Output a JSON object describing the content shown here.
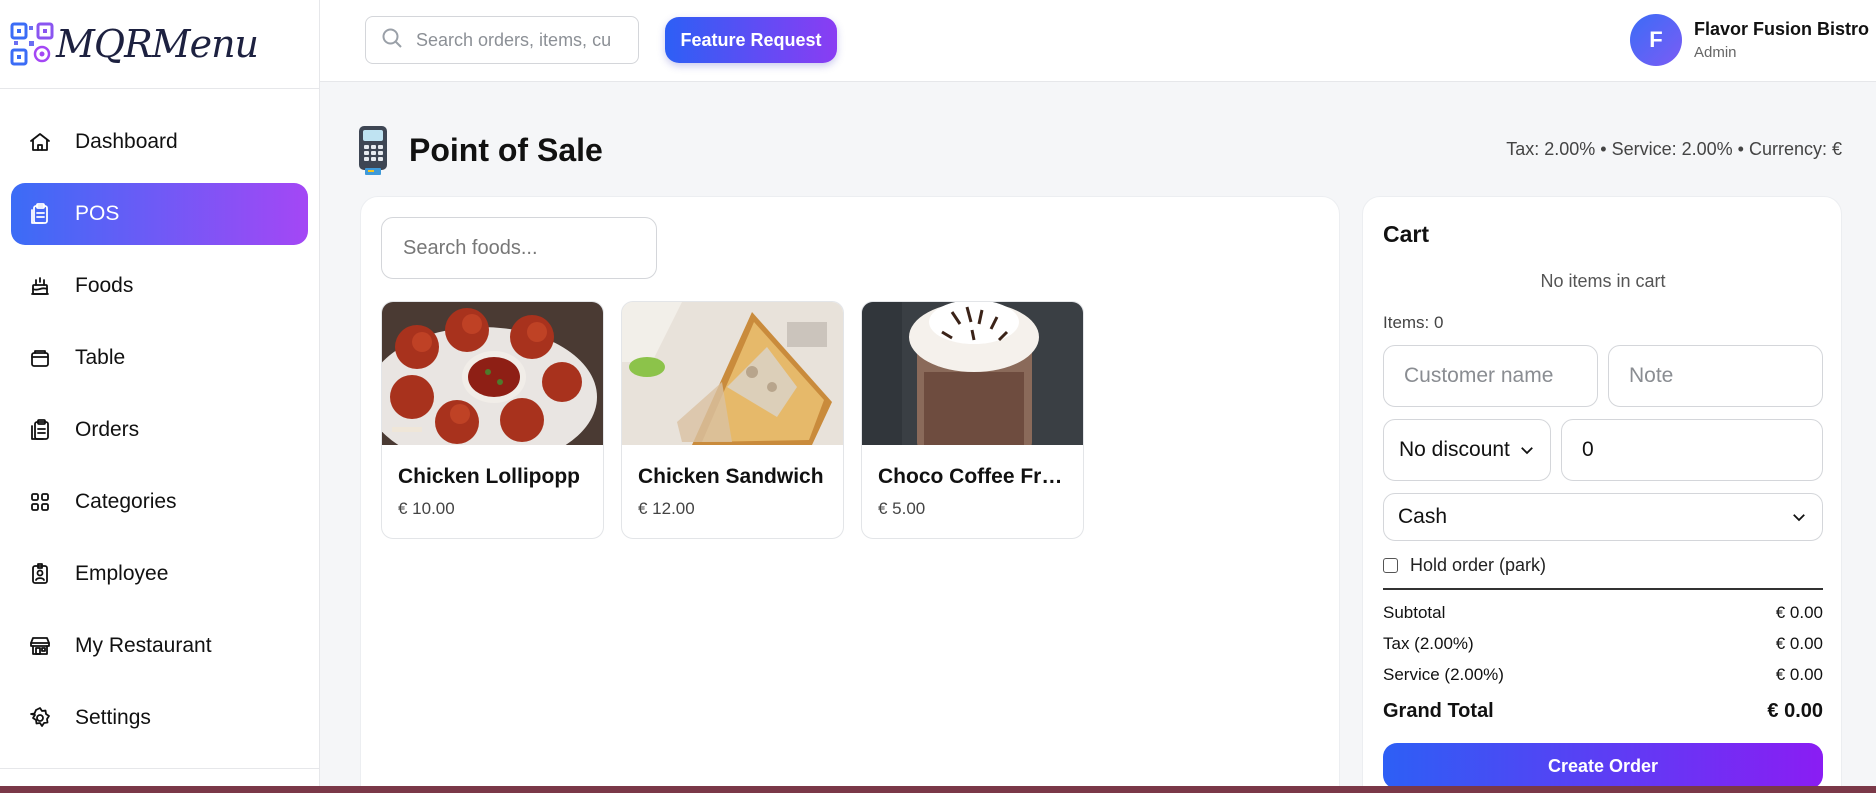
{
  "app": {
    "logo_text": "MQRMenu"
  },
  "sidebar": {
    "items": [
      {
        "label": "Dashboard",
        "icon": "home-icon",
        "active": false
      },
      {
        "label": "POS",
        "icon": "clipboard-icon",
        "active": true
      },
      {
        "label": "Foods",
        "icon": "cake-icon",
        "active": false
      },
      {
        "label": "Table",
        "icon": "table-icon",
        "active": false
      },
      {
        "label": "Orders",
        "icon": "orders-icon",
        "active": false
      },
      {
        "label": "Categories",
        "icon": "grid-icon",
        "active": false
      },
      {
        "label": "Employee",
        "icon": "badge-icon",
        "active": false
      },
      {
        "label": "My Restaurant",
        "icon": "store-icon",
        "active": false
      },
      {
        "label": "Settings",
        "icon": "gear-icon",
        "active": false
      }
    ]
  },
  "topbar": {
    "search_placeholder": "Search orders, items, cu",
    "feature_label": "Feature Request",
    "user": {
      "initial": "F",
      "name": "Flavor Fusion Bistro",
      "role": "Admin"
    }
  },
  "page": {
    "title": "Point of Sale",
    "meta": "Tax: 2.00% • Service: 2.00% • Currency: €"
  },
  "foods": {
    "search_placeholder": "Search foods...",
    "items": [
      {
        "name": "Chicken Lollipopp",
        "price": "€ 10.00"
      },
      {
        "name": "Chicken Sandwich",
        "price": "€ 12.00"
      },
      {
        "name": "Choco Coffee Freeze",
        "price": "€ 5.00"
      }
    ]
  },
  "cart": {
    "title": "Cart",
    "empty_text": "No items in cart",
    "items_count": "Items: 0",
    "customer_placeholder": "Customer name",
    "note_placeholder": "Note",
    "discount_value": "No discount",
    "discount_amount": "0",
    "payment_value": "Cash",
    "hold_label": "Hold order (park)",
    "summary": [
      {
        "label": "Subtotal",
        "value": "€ 0.00"
      },
      {
        "label": "Tax (2.00%)",
        "value": "€ 0.00"
      },
      {
        "label": "Service (2.00%)",
        "value": "€ 0.00"
      }
    ],
    "grand_label": "Grand Total",
    "grand_value": "€ 0.00",
    "create_label": "Create Order"
  },
  "colors": {
    "accent_start": "#3b6cf6",
    "accent_end": "#a447f5"
  }
}
